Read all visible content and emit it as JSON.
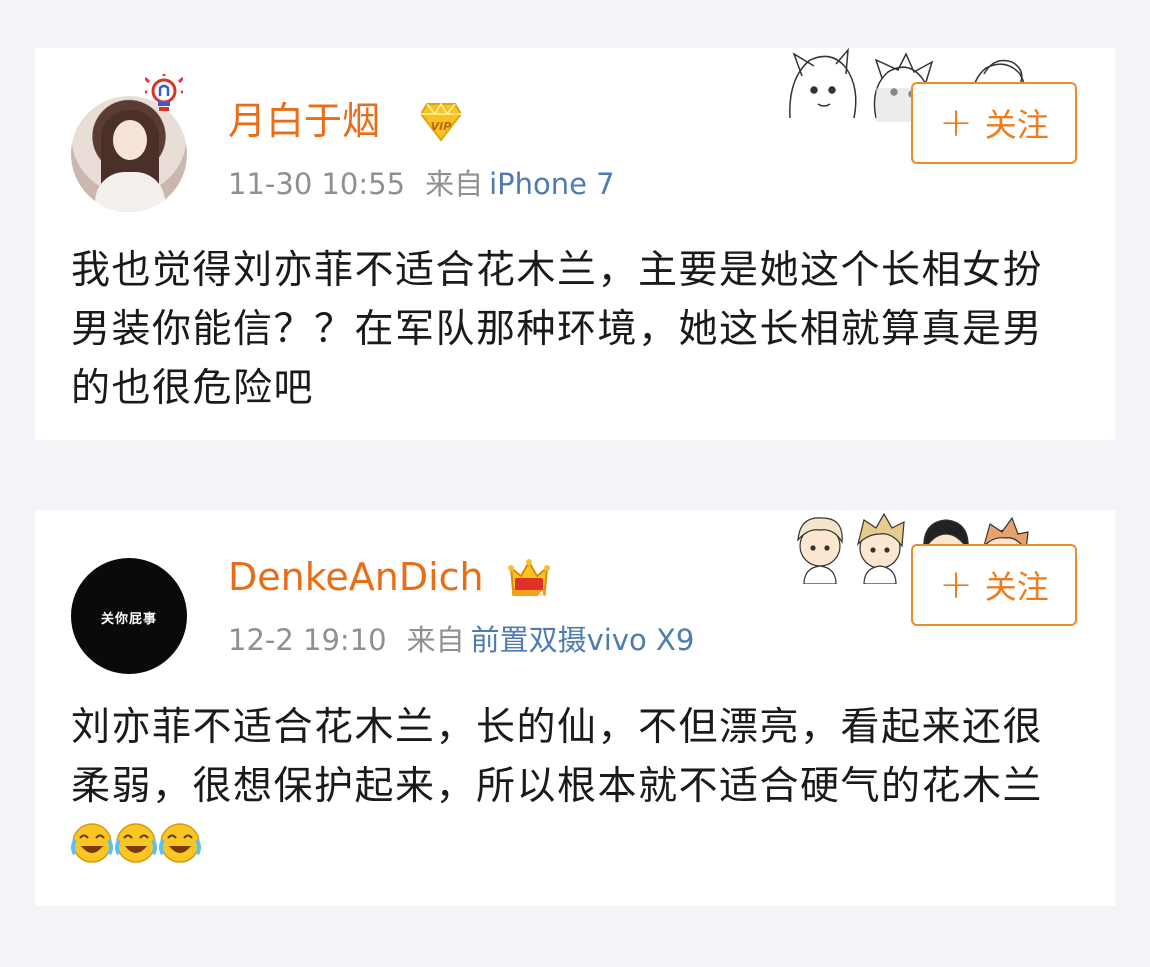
{
  "posts": [
    {
      "username": "月白于烟",
      "badge": "vip-badge-icon",
      "time": "11-30 10:55",
      "source_prefix": "来自",
      "device": "iPhone 7",
      "follow_label": "关注",
      "content": "我也觉得刘亦菲不适合花木兰，主要是她这个长相女扮男装你能信？？在军队那种环境，她这长相就算真是男的也很危险吧"
    },
    {
      "username": "DenkeAnDich",
      "badge": "crown-badge-icon",
      "avatar_text": "关你屁事",
      "time": "12-2 19:10",
      "source_prefix": "来自",
      "device": "前置双摄vivo X9",
      "follow_label": "关注",
      "content": "刘亦菲不适合花木兰，长的仙，不但漂亮，看起来还很柔弱，很想保护起来，所以根本就不适合硬气的花木兰",
      "content_emoji": [
        "laugh-cry-emoji",
        "laugh-cry-emoji",
        "laugh-cry-emoji"
      ]
    }
  ],
  "colors": {
    "username": "#e96d16",
    "follow_border": "#f08a2a",
    "device_link": "#4f7cb0",
    "meta_gray": "#909090",
    "background": "#f2f4f8"
  }
}
